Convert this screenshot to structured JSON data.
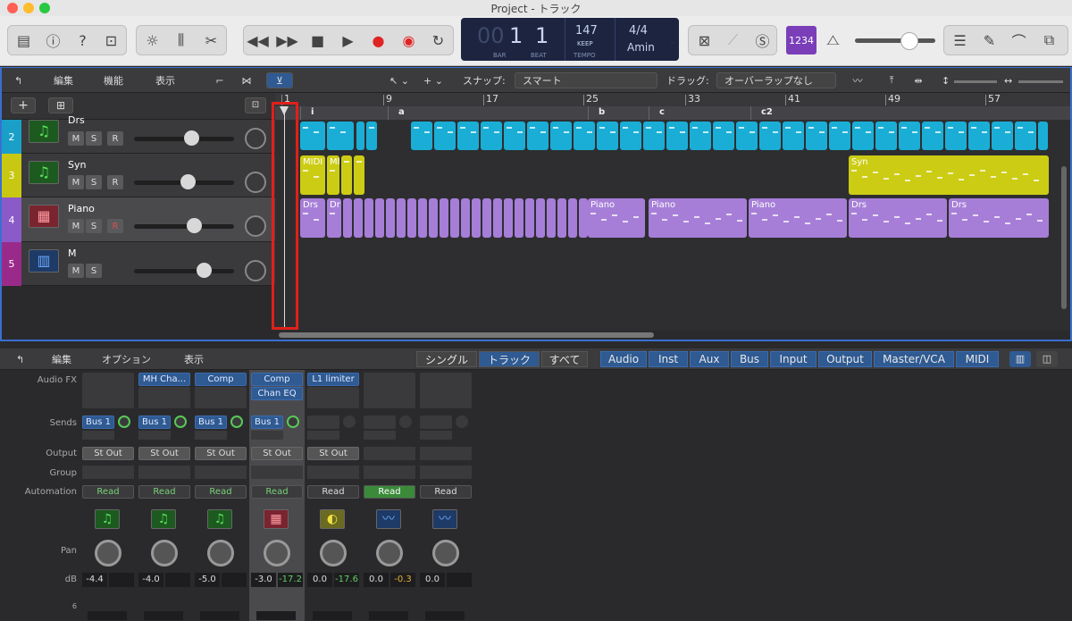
{
  "window": {
    "title": "Project - トラック"
  },
  "lcd": {
    "bar_display": "1",
    "beat_display": "1",
    "bar_dim": "00",
    "bar_label": "BAR",
    "beat_label": "BEAT",
    "tempo": "147",
    "keep": "KEEP",
    "tempo_label": "TEMPO",
    "signature": "4/4",
    "key": "Amin"
  },
  "counter": "1234",
  "tracks_toolbar": {
    "edit": "編集",
    "function": "機能",
    "view": "表示",
    "snap_label": "スナップ:",
    "snap_value": "スマート",
    "drag_label": "ドラッグ:",
    "drag_value": "オーバーラップなし"
  },
  "ruler": {
    "bars": [
      "1",
      "9",
      "17",
      "25",
      "33",
      "41",
      "49",
      "57"
    ],
    "markers": [
      "i",
      "a",
      "b",
      "c",
      "c2"
    ]
  },
  "tracks": [
    {
      "num": "2",
      "name": "Drs",
      "color": "#1aa0c8",
      "m": "M",
      "s": "S",
      "r": "R",
      "fader": 0.8
    },
    {
      "num": "3",
      "name": "Syn",
      "color": "#c8c812",
      "m": "M",
      "s": "S",
      "r": "R",
      "fader": 0.75
    },
    {
      "num": "4",
      "name": "Piano",
      "color": "#8a5ac8",
      "m": "M",
      "s": "S",
      "r": "R",
      "fader": 0.84
    },
    {
      "num": "5",
      "name": "M",
      "color": "#9a2a8a",
      "m": "M",
      "s": "S",
      "r": "",
      "fader": 0.98
    }
  ],
  "regions": {
    "syn_labels": [
      "MIDI",
      "MI"
    ],
    "syn_end": "Syn",
    "piano": [
      "Drs",
      "Dr",
      "Piano",
      "Piano",
      "Piano",
      "Drs",
      "Drs"
    ]
  },
  "mixer_toolbar": {
    "edit": "編集",
    "options": "オプション",
    "view": "表示",
    "tabs": [
      "シングル",
      "トラック",
      "すべて"
    ],
    "filters": [
      "Audio",
      "Inst",
      "Aux",
      "Bus",
      "Input",
      "Output",
      "Master/VCA",
      "MIDI"
    ]
  },
  "mixer_labels": {
    "audio_fx": "Audio FX",
    "sends": "Sends",
    "output": "Output",
    "group": "Group",
    "automation": "Automation",
    "pan": "Pan",
    "db": "dB",
    "scale": "6"
  },
  "strips": [
    {
      "fx": "",
      "send": "Bus 1",
      "output": "St Out",
      "automation": "Read",
      "db": "-4.4",
      "peak": "",
      "icon": "music-note-icon"
    },
    {
      "fx": "MH Cha...",
      "send": "Bus 1",
      "output": "St Out",
      "automation": "Read",
      "db": "-4.0",
      "peak": "",
      "icon": "music-note-icon"
    },
    {
      "fx": "Comp",
      "send": "Bus 1",
      "output": "St Out",
      "automation": "Read",
      "db": "-5.0",
      "peak": "",
      "icon": "music-note-icon"
    },
    {
      "fx": "Comp",
      "fx2": "Chan EQ",
      "send": "Bus 1",
      "output": "St Out",
      "automation": "Read",
      "db": "-3.0",
      "peak": "-17.2",
      "icon": "piano-icon"
    },
    {
      "fx": "L1 limiter",
      "send": "",
      "output": "St Out",
      "automation": "Read",
      "db": "0.0",
      "peak": "-17.6",
      "icon": "gauge-icon"
    },
    {
      "fx": "",
      "send": "",
      "output": "",
      "automation": "Read",
      "db": "0.0",
      "peak": "-0.3",
      "icon": "waveform-icon"
    },
    {
      "fx": "",
      "send": "",
      "output": "",
      "automation": "Read",
      "db": "0.0",
      "peak": "",
      "icon": "waveform-icon"
    }
  ]
}
